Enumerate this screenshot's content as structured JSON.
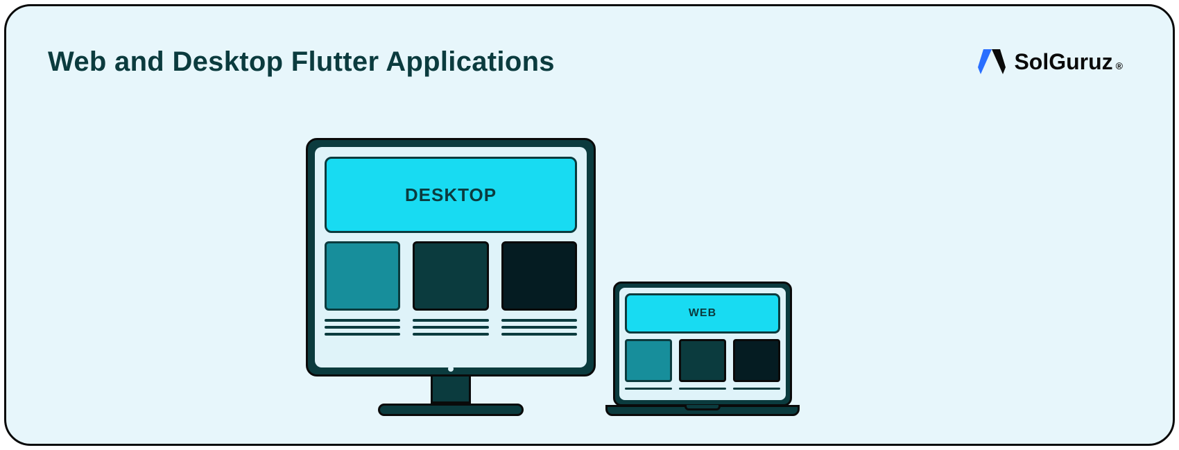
{
  "title": "Web and Desktop Flutter Applications",
  "brand": {
    "name": "SolGuruz",
    "name_prefix": "Sol",
    "name_suffix": "Guruz",
    "registered": "®"
  },
  "illustration": {
    "desktop": {
      "label": "DESKTOP"
    },
    "web": {
      "label": "WEB"
    }
  },
  "palette": {
    "background": "#e7f6fb",
    "frame": "#0b3b3e",
    "screen": "#dff3f9",
    "accent": "#18dbf2",
    "card_a": "#178e9b",
    "card_b": "#0b3b3e",
    "card_c": "#051c22",
    "text": "#0b3b3e",
    "logo_blue": "#2a6fff"
  }
}
